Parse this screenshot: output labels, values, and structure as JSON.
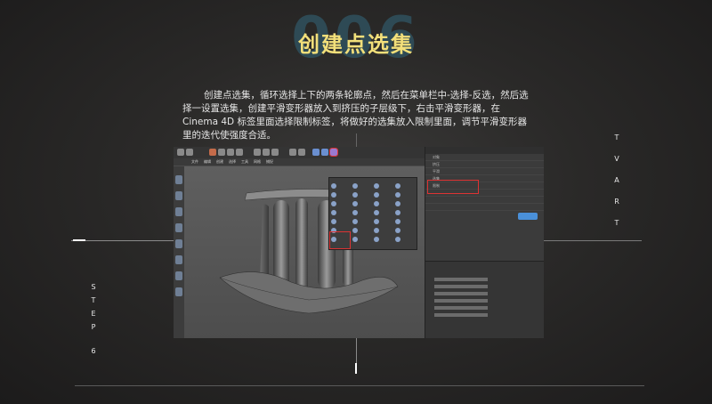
{
  "header": {
    "number": "006",
    "title": "创建点选集"
  },
  "description": {
    "lines": [
      "创建点选集，循环选择上下的两条轮廓点，然后在菜单栏中-选择-反选，然后选",
      "择一设置选集，创建平滑变形器放入到挤压的子层级下，右击平滑变形器，在",
      "Cinema 4D 标签里面选择限制标签，将做好的选集放入限制里面，调节平滑变形器",
      "里的迭代使强度合适。"
    ]
  },
  "side_labels": {
    "right": [
      "T",
      "V",
      "A",
      "R",
      "T"
    ],
    "left": [
      "S",
      "T",
      "E",
      "P",
      "6"
    ]
  },
  "screenshot": {
    "menu": [
      "文件",
      "编辑",
      "创建",
      "选择",
      "工具",
      "网格",
      "捕捉"
    ],
    "dropdown_items": [
      "",
      "",
      "",
      "",
      "",
      "",
      "",
      "",
      "",
      "",
      "",
      "",
      "",
      "",
      "",
      "",
      "",
      "",
      "",
      "",
      "",
      "",
      "",
      "",
      "",
      "",
      "",
      "",
      "",
      "",
      "",
      ""
    ],
    "right_panel_rows": [
      "对象",
      "挤压",
      "平滑",
      "选集",
      "限制",
      "",
      "",
      ""
    ],
    "panel_button": "",
    "attr_rows": [
      "",
      "",
      "",
      "",
      "",
      "",
      "",
      ""
    ]
  },
  "colors": {
    "title": "#f2df7a",
    "bignum": "#2e4a55",
    "highlight": "#dd3333"
  }
}
